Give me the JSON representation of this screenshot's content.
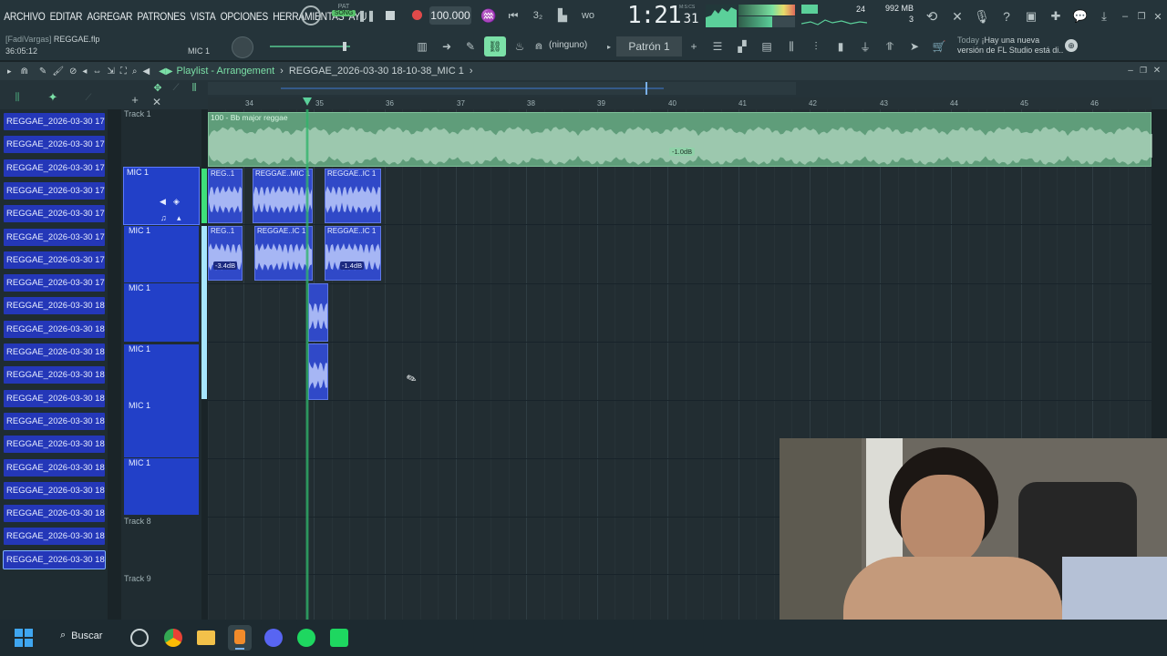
{
  "menu": [
    "ARCHIVO",
    "EDITAR",
    "AGREGAR",
    "PATRONES",
    "VISTA",
    "OPCIONES",
    "HERRAMIENTAS",
    "AYU"
  ],
  "transport": {
    "mode_pat": "PAT",
    "mode_song": "SONG",
    "tempo": "100.000",
    "time_main": "1:21",
    "time_sub": "31",
    "time_label": "M:S:CS"
  },
  "meter": {
    "cpu": "24",
    "memory": "992 MB",
    "voices": "3"
  },
  "project": {
    "user": "[FadiVargas]",
    "file": "REGGAE.flp",
    "clock": "36:05:12",
    "channel": "MIC 1"
  },
  "pattern": {
    "snap": "(ninguno)",
    "name": "Patrón 1"
  },
  "news": {
    "when": "Today",
    "line1": "¡Hay una nueva",
    "line2": "versión de FL Studio está di.."
  },
  "playlist": {
    "title": "Playlist - Arrangement",
    "clip_name": "REGGAE_2026-03-30 18-10-38_MIC 1"
  },
  "ruler": [
    "34",
    "35",
    "36",
    "37",
    "38",
    "39",
    "40",
    "41",
    "42",
    "43",
    "44",
    "45",
    "46"
  ],
  "browser_items": [
    "REGGAE_2026-03-30 17-..",
    "REGGAE_2026-03-30 17-..",
    "REGGAE_2026-03-30 17-..",
    "REGGAE_2026-03-30 17-..",
    "REGGAE_2026-03-30 17-..",
    "REGGAE_2026-03-30 17-..",
    "REGGAE_2026-03-30 17-..",
    "REGGAE_2026-03-30 17-..",
    "REGGAE_2026-03-30 18-..",
    "REGGAE_2026-03-30 18-..",
    "REGGAE_2026-03-30 18-..",
    "REGGAE_2026-03-30 18-..",
    "REGGAE_2026-03-30 18-..",
    "REGGAE_2026-03-30 18-..",
    "REGGAE_2026-03-30 18-..",
    "REGGAE_2026-03-30 18-..",
    "REGGAE_2026-03-30 18-..",
    "REGGAE_2026-03-30 18-..",
    "REGGAE_2026-03-30 18-..",
    "REGGAE_2026-03-30 18-.."
  ],
  "tracks": {
    "t1": "Track 1",
    "mic": "MIC 1",
    "t8": "Track 8",
    "t9": "Track 9"
  },
  "audio_clip": {
    "label": "100 - Bb major reggae",
    "db": "-1.0dB"
  },
  "clips": {
    "c1": "REG..1",
    "c2": "REGGAE..MIC 1",
    "c3": "REGGAE..IC 1",
    "c4": "REG..1",
    "c5": "REGGAE..IC 1",
    "c6": "REGGAE..IC 1",
    "db1": "-3.4dB",
    "db2": "-1.4dB"
  },
  "taskbar": {
    "search": "Buscar"
  }
}
